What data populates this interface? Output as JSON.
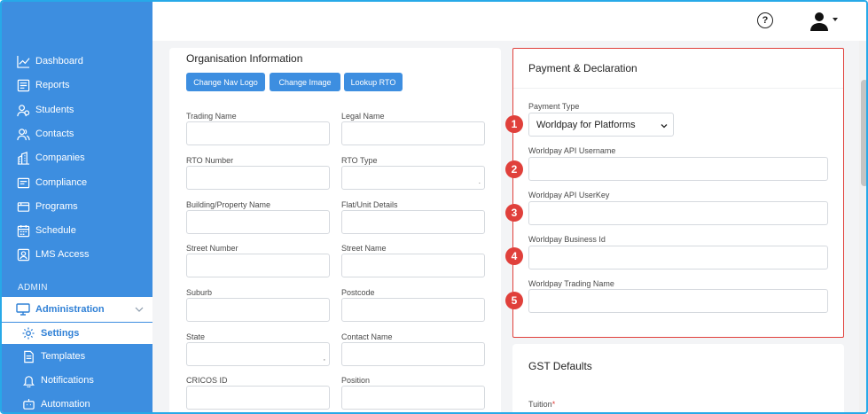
{
  "sidebar": {
    "items": [
      {
        "label": "Dashboard",
        "icon": "chart-line-icon"
      },
      {
        "label": "Reports",
        "icon": "report-icon"
      },
      {
        "label": "Students",
        "icon": "students-icon"
      },
      {
        "label": "Contacts",
        "icon": "contacts-icon"
      },
      {
        "label": "Companies",
        "icon": "companies-icon"
      },
      {
        "label": "Compliance",
        "icon": "compliance-icon"
      },
      {
        "label": "Programs",
        "icon": "programs-icon"
      },
      {
        "label": "Schedule",
        "icon": "calendar-icon"
      },
      {
        "label": "LMS Access",
        "icon": "lms-icon"
      }
    ],
    "section_label": "ADMIN",
    "admin": {
      "label": "Administration",
      "icon": "monitor-icon"
    },
    "settings": {
      "label": "Settings",
      "icon": "gear-icon"
    },
    "sub_items": [
      {
        "label": "Templates",
        "icon": "template-icon"
      },
      {
        "label": "Notifications",
        "icon": "bell-icon"
      },
      {
        "label": "Automation",
        "icon": "automation-icon"
      }
    ]
  },
  "topbar": {
    "help": "?"
  },
  "org": {
    "title": "Organisation Information",
    "buttons": [
      "Change Nav Logo",
      "Change Image",
      "Lookup RTO"
    ],
    "fields": [
      "Trading Name",
      "Legal Name",
      "RTO Number",
      "RTO Type",
      "Building/Property Name",
      "Flat/Unit Details",
      "Street Number",
      "Street Name",
      "Suburb",
      "Postcode",
      "State",
      "Contact Name",
      "CRICOS ID",
      "Position"
    ]
  },
  "payment": {
    "title": "Payment & Declaration",
    "type_label": "Payment Type",
    "type_value": "Worldpay for Platforms",
    "fields": [
      "Worldpay API Username",
      "Worldpay API UserKey",
      "Worldpay Business Id",
      "Worldpay Trading Name"
    ],
    "badges": [
      "1",
      "2",
      "3",
      "4",
      "5"
    ]
  },
  "gst": {
    "title": "GST Defaults",
    "tuition_label": "Tuition",
    "required_mark": "*"
  },
  "colors": {
    "sidebar": "#3d8ee0",
    "accent": "#2f80d6",
    "highlight": "#e0403b",
    "frame": "#27a9e8"
  }
}
